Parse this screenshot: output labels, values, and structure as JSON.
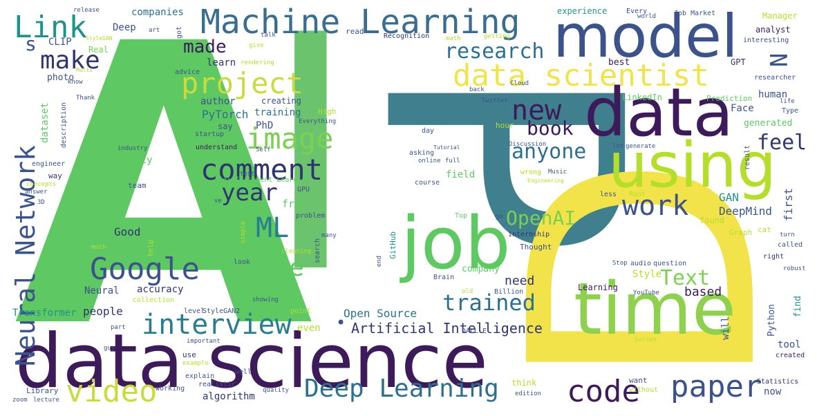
{
  "colors": {
    "green": "#5ec962",
    "yellow": "#f2e34a",
    "lime": "#a8d84a",
    "teal": "#277f8e",
    "blue": "#3b528b",
    "navy": "#31356e",
    "purple": "#3d1a5a",
    "aqua": "#21918c",
    "mint": "#7ad151",
    "light": "#b5de2b"
  },
  "words": {
    "AI_A": "A",
    "AI_I": "I",
    "D": "D",
    "P": "P",
    "data_science": "data science",
    "model": "model",
    "data": "data",
    "using": "using",
    "time": "time",
    "job": "job",
    "machine_learning": "Machine Learning",
    "data_scientist": "data scientist",
    "project": "project",
    "image": "image",
    "comment": "comment",
    "google": "Google",
    "interview": "interview",
    "deep_learning": "Deep Learning",
    "paper": "paper",
    "code": "code",
    "video": "video",
    "neural_network": "Neural Network",
    "link": "Link",
    "make": "make",
    "made": "made",
    "research": "research",
    "new": "new",
    "book": "book",
    "anyone": "anyone",
    "feel": "feel",
    "work": "work",
    "year": "year",
    "ml": "ML",
    "one": "one",
    "trained": "trained",
    "openai": "OpenAI",
    "text": "Text",
    "artificial_intelligence": "Artificial Intelligence",
    "open_source": "Open Source",
    "need": "need",
    "based": "based",
    "people": "people",
    "accuracy": "accuracy",
    "neural": "Neural",
    "transformer": "Transformer",
    "good": "Good",
    "pytorch": "PyTorch",
    "author": "author",
    "training": "training",
    "phd": "PhD",
    "free": "free",
    "field": "field",
    "gan": "GAN",
    "deepmind": "DeepMind",
    "first": "first",
    "human": "human",
    "face": "Face",
    "generated": "generated",
    "style": "Style",
    "learning": "Learning",
    "python": "Python",
    "tool": "tool",
    "created": "created",
    "algorithm": "algorithm",
    "now": "now",
    "s": "s",
    "n": "N",
    "companies": "companies",
    "deep": "Deep",
    "clip": "CLIP",
    "real": "Real",
    "photo": "photo",
    "learn": "learn",
    "best": "best",
    "gpt": "GPT",
    "experience": "experience",
    "every": "Every",
    "job_market": "Job Market",
    "manager": "Manager",
    "analyst": "analyst",
    "interesting": "interesting",
    "linkedin": "LinkedIn",
    "prediction": "Prediction",
    "researcher": "researcher",
    "dataset": "dataset",
    "description": "description",
    "engineer": "engineer",
    "way": "way",
    "team": "team",
    "answer": "answer",
    "concepts": "concepts",
    "3d": "3D",
    "really": "really",
    "industry": "industry",
    "startup": "startup",
    "understand": "understand",
    "say": "say",
    "creating": "creating",
    "high": "High",
    "everything": "Everything",
    "test": "test",
    "self": "Self",
    "gpu": "GPU",
    "reinforcement_learning": "Reinforcement Learning",
    "problem": "problem",
    "many": "many",
    "search": "search",
    "github": "GitHub",
    "end": "end",
    "cleaning": "cleaning",
    "help": "help",
    "much": "much",
    "look": "look",
    "simple": "simple",
    "ve": "ve",
    "top": "Top",
    "go": "go",
    "internship": "internship",
    "thought": "Thought",
    "company": "company",
    "brain": "Brain",
    "old": "old",
    "billion": "Billion",
    "dall_e": "DALL E",
    "even": "even",
    "collection": "collection",
    "level": "level",
    "stylegan2": "StyleGAN2",
    "point": "point",
    "showing": "showing",
    "part": "part",
    "important": "important",
    "use": "use",
    "guy": "guy",
    "example": "example",
    "explain": "explain",
    "well": "well",
    "realistic": "realistic",
    "library": "Library",
    "zoom": "zoom",
    "lecture": "lecture",
    "working": "working",
    "quality": "quality",
    "think": "think",
    "edition": "edition",
    "without": "without",
    "want": "want",
    "series": "Series",
    "statistics": "Statistics",
    "will": "will",
    "find": "find",
    "robust": "robust",
    "called": "called",
    "right": "right",
    "turn": "turn",
    "cat": "cat",
    "graph": "Graph",
    "found": "found",
    "stop": "Stop",
    "audio": "audio",
    "question": "question",
    "youtube": "YouTube",
    "less": "less",
    "rant": "Rant",
    "result": "result",
    "lot": "lot",
    "generate": "generate",
    "type": "Type",
    "life": "life",
    "twitter": "Twitter",
    "back": "back",
    "cloud": "Cloud",
    "world": "world",
    "recognition": "Recognition",
    "getting": "getting",
    "math": "math",
    "read": "read",
    "talk": "talk",
    "give": "give",
    "rendering": "rendering",
    "advice": "advice",
    "got": "got",
    "art": "art",
    "release": "release",
    "stylegan": "StyleGAN",
    "multi": "Multi",
    "know": "know",
    "thank": "Thank",
    "hour": "hour",
    "discussion": "Discussion",
    "wrong": "wrong",
    "music": "Music",
    "engineering": "Engineering",
    "asking": "asking",
    "tutorial": "Tutorial",
    "online": "online",
    "full": "full",
    "course": "course",
    "day": "day",
    "bullet": "•"
  }
}
